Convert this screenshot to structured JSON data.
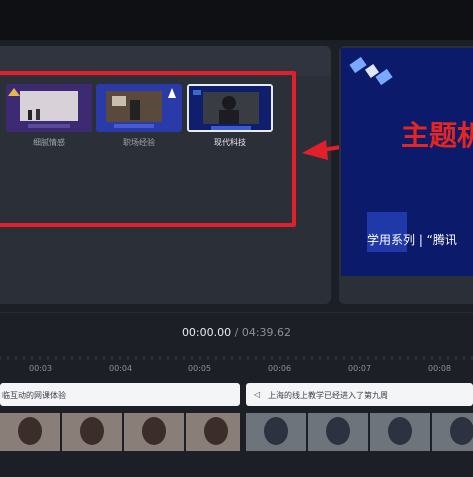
{
  "templates": [
    {
      "label": "细腻情感"
    },
    {
      "label": "职场经验"
    },
    {
      "label": "现代科技"
    }
  ],
  "preview": {
    "title": "主题机",
    "subtitle": "学用系列 | “腾讯"
  },
  "player": {
    "current": "00:00.00",
    "separator": " / ",
    "total": "04:39.62"
  },
  "ruler": {
    "ticks": [
      "00:03",
      "00:04",
      "00:05",
      "00:06",
      "00:07",
      "00:08"
    ]
  },
  "subtitles": [
    {
      "text": "临互动的网课体验"
    },
    {
      "text": "上海的线上教学已经进入了第九周"
    }
  ],
  "colors": {
    "highlight": "#e0202a",
    "accent_blue": "#0b1a6b"
  }
}
